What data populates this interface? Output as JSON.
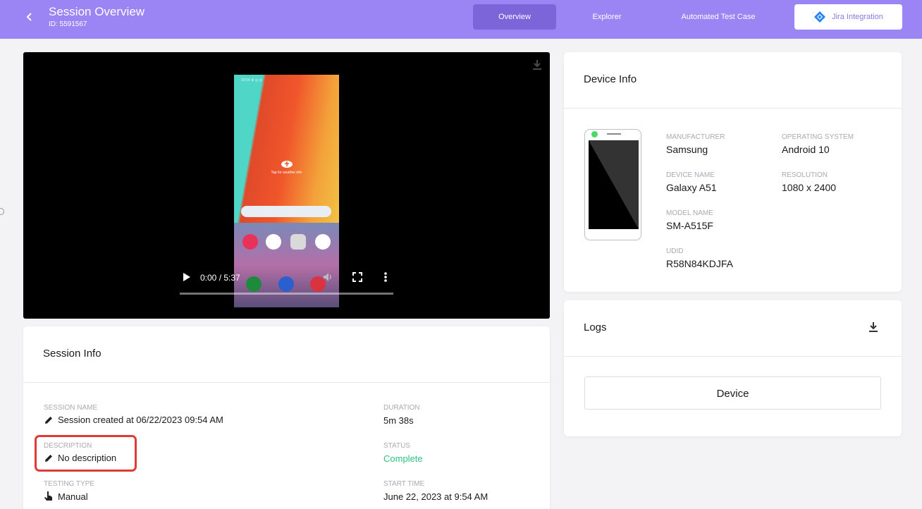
{
  "header": {
    "title": "Session Overview",
    "session_id": "ID: 5591567",
    "tabs": [
      {
        "label": "Overview"
      },
      {
        "label": "Explorer"
      },
      {
        "label": "Automated Test Case"
      },
      {
        "label": "Jira Integration"
      }
    ],
    "accent": "#9b84f4"
  },
  "video": {
    "time": "0:00 / 5:37",
    "screen_weather": "Tap for weather info",
    "progress": 0
  },
  "session_info": {
    "title": "Session Info",
    "session_name_label": "SESSION NAME",
    "session_name": "Session created at 06/22/2023 09:54 AM",
    "description_label": "DESCRIPTION",
    "description": "No description",
    "testing_type_label": "TESTING TYPE",
    "testing_type": "Manual",
    "duration_label": "DURATION",
    "duration": "5m 38s",
    "status_label": "STATUS",
    "status": "Complete",
    "start_time_label": "START TIME",
    "start_time": "June 22, 2023 at 9:54 AM"
  },
  "device_info": {
    "title": "Device Info",
    "manufacturer_label": "MANUFACTURER",
    "manufacturer": "Samsung",
    "os_label": "OPERATING SYSTEM",
    "os": "Android 10",
    "device_name_label": "DEVICE NAME",
    "device_name": "Galaxy A51",
    "resolution_label": "RESOLUTION",
    "resolution": "1080 x 2400",
    "model_name_label": "MODEL NAME",
    "model_name": "SM-A515F",
    "udid_label": "UDID",
    "udid": "R58N84KDJFA"
  },
  "logs": {
    "title": "Logs",
    "device_button": "Device"
  }
}
